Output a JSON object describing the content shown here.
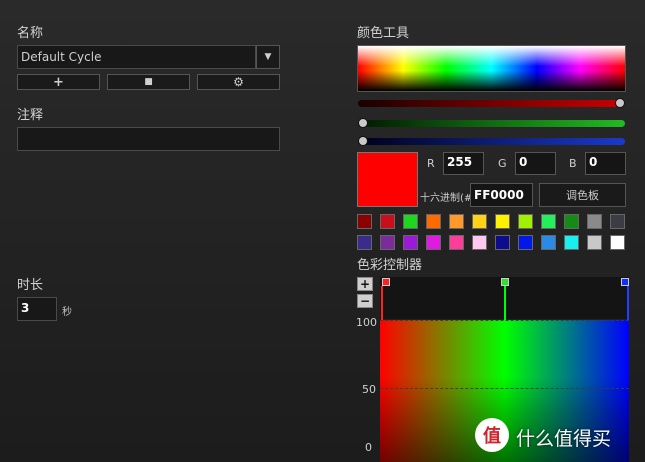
{
  "left": {
    "name_label": "名称",
    "profile_value": "Default Cycle",
    "buttons": [
      "+",
      "■",
      "⚙"
    ],
    "note_label": "注释",
    "note_value": "",
    "duration_label": "时长",
    "duration_value": "3",
    "duration_unit": "秒"
  },
  "color_tool": {
    "title": "颜色工具",
    "rgb": {
      "r_label": "R",
      "r": "255",
      "g_label": "G",
      "g": "0",
      "b_label": "B",
      "b": "0"
    },
    "sliders": {
      "red": 1.0,
      "green": 0.0,
      "blue": 0.0
    },
    "hex_label": "十六进制(#",
    "hex": "FF0000",
    "palette_button": "调色板",
    "current_color": "#FF0000",
    "swatches_row1": [
      "#8b0000",
      "#c8101a",
      "#1fd71f",
      "#ff6a00",
      "#ff9a2a",
      "#ffd21a",
      "#fff200",
      "#a0f000",
      "#23f05a",
      "#168a16",
      "#8a8a8a",
      "#3c3c44"
    ],
    "swatches_row2": [
      "#3a2c8c",
      "#7a2c9a",
      "#9a1ad7",
      "#e01ae0",
      "#ff3c9a",
      "#ffc8f0",
      "#0c0c8c",
      "#0018e8",
      "#2a8ae8",
      "#18f0f0",
      "#c8c8c8",
      "#ffffff"
    ]
  },
  "controller": {
    "title": "色彩控制器",
    "plus": "+",
    "minus": "−",
    "ticks": [
      "100",
      "50",
      "0"
    ],
    "stops": [
      "#ff0000",
      "#00ff00",
      "#0000ff"
    ]
  },
  "watermark": {
    "symbol": "值",
    "text": "什么值得买"
  }
}
